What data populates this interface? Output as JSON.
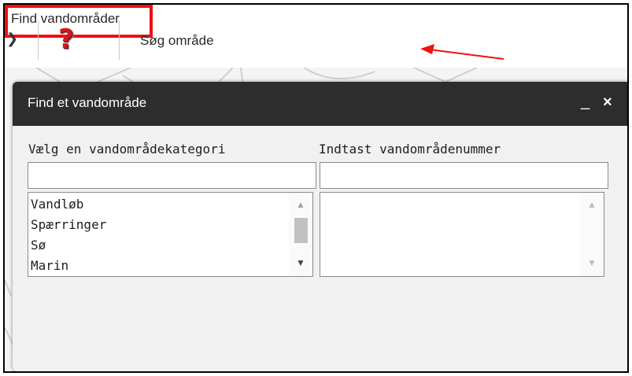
{
  "toolbar": {
    "chevron_icon": "chevron-right-icon",
    "help_icon": "help-question-icon",
    "help_glyph": "?",
    "search_area_label": "Søg område",
    "find_water_label": "Find vandområder",
    "highlight_color": "#ee1111"
  },
  "dialog": {
    "title": "Find et vandområde",
    "minimize_glyph": "_",
    "close_glyph": "×",
    "category": {
      "label": "Vælg en vandområdekategori",
      "input_value": "",
      "items": [
        "Vandløb",
        "Spærringer",
        "Sø",
        "Marin"
      ]
    },
    "number": {
      "label": "Indtast vandområdenummer",
      "input_value": "",
      "items": []
    }
  },
  "colors": {
    "dialog_header": "#2d2d2d",
    "dialog_body": "#f1f1f1",
    "annotation_red": "#ee1111"
  }
}
